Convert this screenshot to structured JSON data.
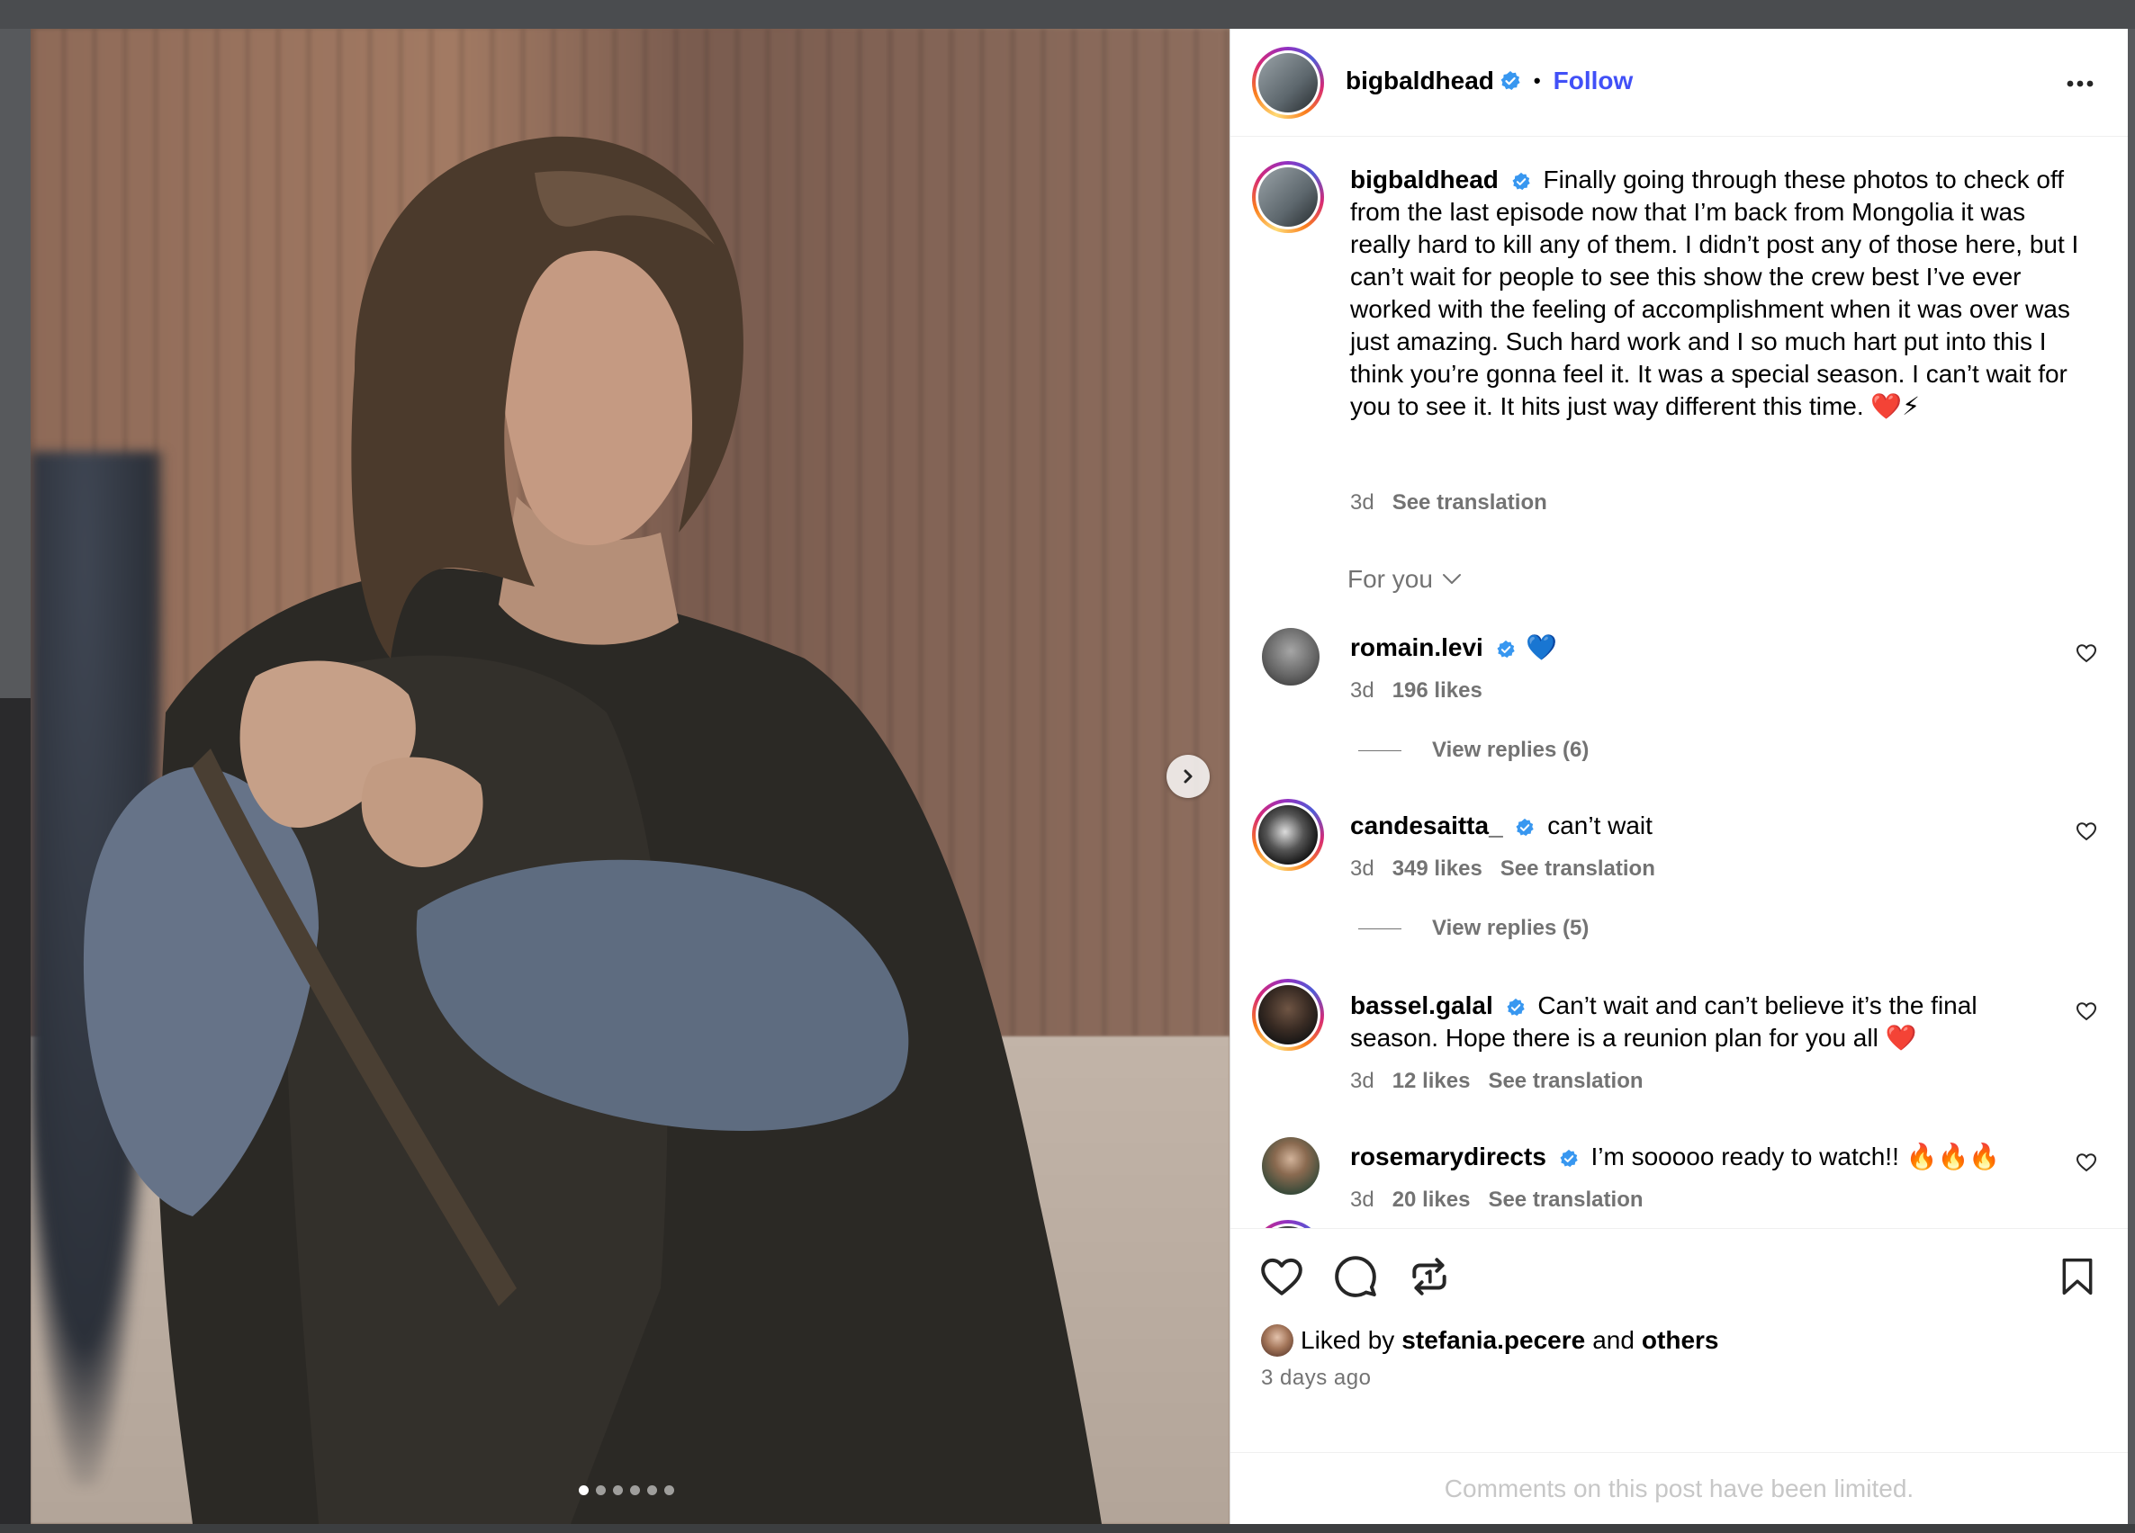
{
  "post": {
    "username": "bigbaldhead",
    "separator": "•",
    "follow_label": "Follow",
    "more_icon": "more-horizontal-icon",
    "carousel": {
      "current_slide": 1,
      "total_slides": 6
    }
  },
  "caption": {
    "username": "bigbaldhead",
    "text": "Finally going through these photos to check off from the last episode now that I’m back from Mongolia it was really hard to kill any of them. I didn’t post any of those here, but I can’t wait for people to see this show the crew best I’ve ever worked with the feeling of accomplishment when it was over was just amazing. Such hard work and I so much hart put into this I think you’re gonna feel it. It was a special season. I can’t wait for you to see it. It hits just way different this time. ❤️⚡",
    "time": "3d",
    "see_translation": "See translation"
  },
  "filter": {
    "label": "For you"
  },
  "comments": [
    {
      "username": "romain.levi",
      "text": "💙",
      "time": "3d",
      "likes": "196 likes",
      "translation": "",
      "replies": "View replies (6)"
    },
    {
      "username": "candesaitta_",
      "text": "can’t wait",
      "time": "3d",
      "likes": "349 likes",
      "translation": "See translation",
      "replies": "View replies (5)"
    },
    {
      "username": "bassel.galal",
      "text": "Can’t wait and can’t believe it’s the final season. Hope there is a reunion plan for you all ❤️",
      "time": "3d",
      "likes": "12 likes",
      "translation": "See translation",
      "replies": ""
    },
    {
      "username": "rosemarydirects",
      "text": "I’m sooooo ready to watch!! 🔥🔥🔥",
      "time": "3d",
      "likes": "20 likes",
      "translation": "See translation",
      "replies": ""
    }
  ],
  "likes": {
    "prefix": "Liked by",
    "user": "stefania.pecere",
    "and": "and",
    "others": "others",
    "time_ago": "3 days ago"
  },
  "comments_limited": "Comments on this post have been limited.",
  "colors": {
    "follow": "#4150f7",
    "secondary_text": "#737373",
    "verified": "#3897f0",
    "limited_text": "#c7c7c7"
  }
}
